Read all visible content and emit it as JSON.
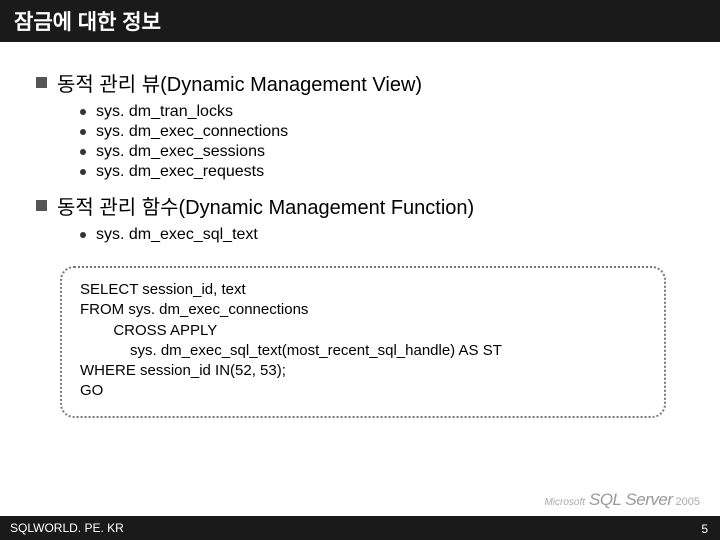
{
  "title": "잠금에 대한 정보",
  "sections": [
    {
      "heading": "동적 관리 뷰(Dynamic Management View)",
      "items": [
        "sys. dm_tran_locks",
        "sys. dm_exec_connections",
        "sys. dm_exec_sessions",
        "sys. dm_exec_requests"
      ]
    },
    {
      "heading": "동적 관리 함수(Dynamic Management Function)",
      "items": [
        "sys. dm_exec_sql_text"
      ]
    }
  ],
  "code": [
    "SELECT session_id, text",
    "FROM sys. dm_exec_connections",
    "        CROSS APPLY",
    "            sys. dm_exec_sql_text(most_recent_sql_handle) AS ST",
    "WHERE session_id IN(52, 53);",
    "GO"
  ],
  "footer": "SQLWORLD. PE. KR",
  "logo": {
    "ms": "Microsoft",
    "product": "SQL Server",
    "year": "2005"
  },
  "page": "5"
}
